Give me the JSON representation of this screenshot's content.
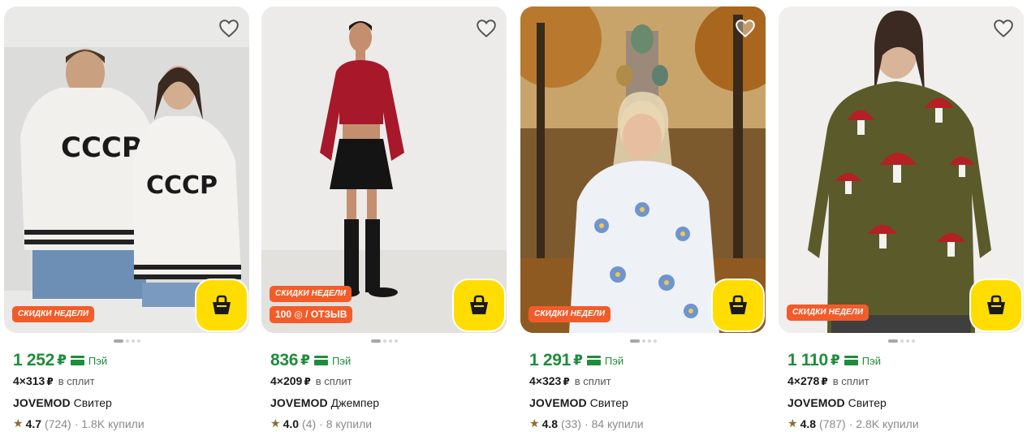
{
  "products": [
    {
      "badge": "СКИДКИ НЕДЕЛИ",
      "extra_badge": "",
      "price": "1 252",
      "currency": "₽",
      "pay_label": "Пэй",
      "split_amount": "4×313",
      "split_currency": "₽",
      "split_label": "в сплит",
      "brand": "JOVEMOD",
      "title": "Свитер",
      "rating": "4.7",
      "reviews": "(724)",
      "bought": "· 1.8K купили"
    },
    {
      "badge": "СКИДКИ НЕДЕЛИ",
      "extra_badge": "100 ◎ / ОТЗЫВ",
      "price": "836",
      "currency": "₽",
      "pay_label": "Пэй",
      "split_amount": "4×209",
      "split_currency": "₽",
      "split_label": "в сплит",
      "brand": "JOVEMOD",
      "title": "Джемпер",
      "rating": "4.0",
      "reviews": "(4)",
      "bought": "· 8 купили"
    },
    {
      "badge": "СКИДКИ НЕДЕЛИ",
      "extra_badge": "",
      "price": "1 291",
      "currency": "₽",
      "pay_label": "Пэй",
      "split_amount": "4×323",
      "split_currency": "₽",
      "split_label": "в сплит",
      "brand": "JOVEMOD",
      "title": "Свитер",
      "rating": "4.8",
      "reviews": "(33)",
      "bought": "· 84 купили"
    },
    {
      "badge": "СКИДКИ НЕДЕЛИ",
      "extra_badge": "",
      "price": "1 110",
      "currency": "₽",
      "pay_label": "Пэй",
      "split_amount": "4×278",
      "split_currency": "₽",
      "split_label": "в сплит",
      "brand": "JOVEMOD",
      "title": "Свитер",
      "rating": "4.8",
      "reviews": "(787)",
      "bought": "· 2.8K купили"
    }
  ],
  "image_text": {
    "sweater_print_1": "СССР",
    "sweater_print_2": "СССР"
  },
  "colors": {
    "price_green": "#1f8c3b",
    "badge_orange": "#f25c2a",
    "cart_yellow": "#ffdd00",
    "star": "#8a6d2e"
  },
  "icons": {
    "favorite": "heart-icon",
    "cart": "basket-icon",
    "pay": "pay-card-icon",
    "rating": "star-icon"
  }
}
